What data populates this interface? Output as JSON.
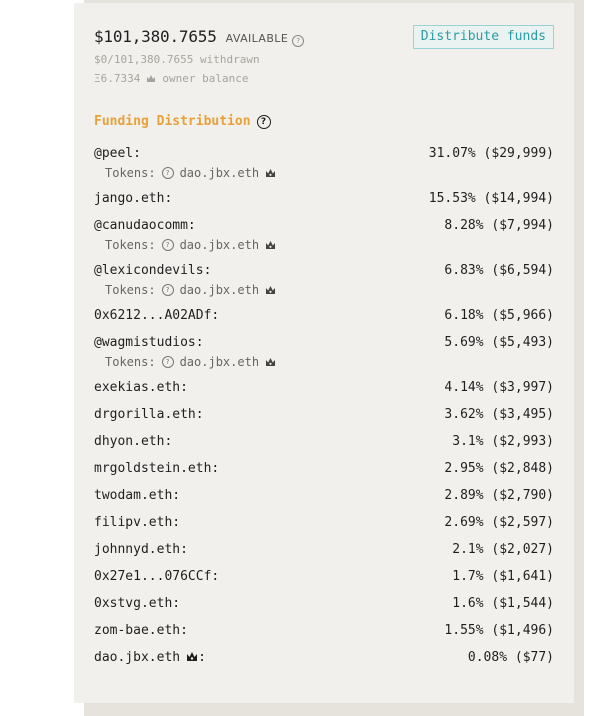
{
  "balance": {
    "amount": "$101,380.7655",
    "available_label": "AVAILABLE",
    "withdrawn": "$0/101,380.7655 withdrawn",
    "owner_eth": "Ξ6.7334",
    "owner_label": "owner balance"
  },
  "distribute_button": "Distribute funds",
  "section": {
    "title": "Funding Distribution"
  },
  "tokens_prefix": "Tokens:",
  "distributions": [
    {
      "name": "@peel:",
      "value": "31.07% ($29,999)",
      "tokens": "dao.jbx.eth"
    },
    {
      "name": "jango.eth:",
      "value": "15.53% ($14,994)"
    },
    {
      "name": "@canudaocomm:",
      "value": "8.28% ($7,994)",
      "tokens": "dao.jbx.eth"
    },
    {
      "name": "@lexicondevils:",
      "value": "6.83% ($6,594)",
      "tokens": "dao.jbx.eth"
    },
    {
      "name": "0x6212...A02ADf:",
      "value": "6.18% ($5,966)"
    },
    {
      "name": "@wagmistudios:",
      "value": "5.69% ($5,493)",
      "tokens": "dao.jbx.eth"
    },
    {
      "name": "exekias.eth:",
      "value": "4.14% ($3,997)"
    },
    {
      "name": "drgorilla.eth:",
      "value": "3.62% ($3,495)"
    },
    {
      "name": "dhyon.eth:",
      "value": "3.1% ($2,993)"
    },
    {
      "name": "mrgoldstein.eth:",
      "value": "2.95% ($2,848)"
    },
    {
      "name": "twodam.eth:",
      "value": "2.89% ($2,790)"
    },
    {
      "name": "filipv.eth:",
      "value": "2.69% ($2,597)"
    },
    {
      "name": "johnnyd.eth:",
      "value": "2.1% ($2,027)"
    },
    {
      "name": "0x27e1...076CCf:",
      "value": "1.7% ($1,641)"
    },
    {
      "name": "0xstvg.eth:",
      "value": "1.6% ($1,544)"
    },
    {
      "name": "zom-bae.eth:",
      "value": "1.55% ($1,496)"
    },
    {
      "name": "dao.jbx.eth",
      "name_suffix": ":",
      "owner": true,
      "value": "0.08% ($77)"
    }
  ]
}
